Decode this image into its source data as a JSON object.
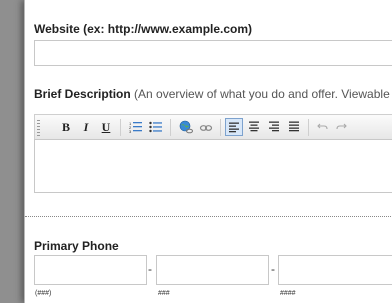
{
  "website": {
    "label": "Website (ex: http://www.example.com)",
    "value": ""
  },
  "description": {
    "label": "Brief Description",
    "hint": "(An overview of what you do and offer. Viewable in the p",
    "value": ""
  },
  "toolbar": {
    "bold": "B",
    "italic": "I",
    "underline": "U"
  },
  "phone": {
    "label": "Primary Phone",
    "dash1": "-",
    "dash2": "-",
    "hint_area": "(###)",
    "hint_prefix": "###",
    "hint_line": "####"
  }
}
